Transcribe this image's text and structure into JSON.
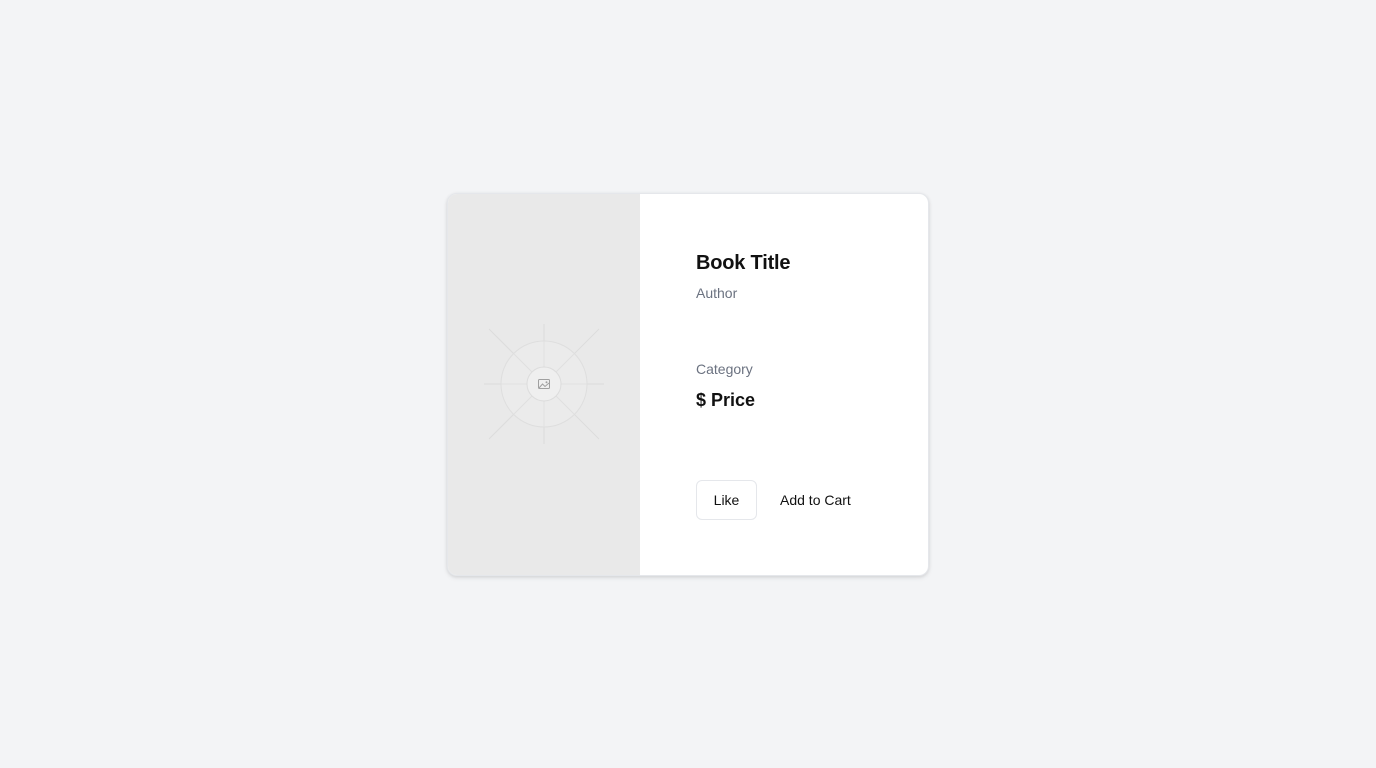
{
  "product": {
    "title": "Book Title",
    "author": "Author",
    "category": "Category",
    "price": "$ Price",
    "cover_icon": "image-placeholder-icon"
  },
  "actions": {
    "like_label": "Like",
    "cart_label": "Add to Cart"
  },
  "colors": {
    "page_background": "#f3f4f6",
    "card_background": "#ffffff",
    "cover_background": "#e9e9e9",
    "muted_text": "#6b7280",
    "primary_text": "#111111"
  }
}
